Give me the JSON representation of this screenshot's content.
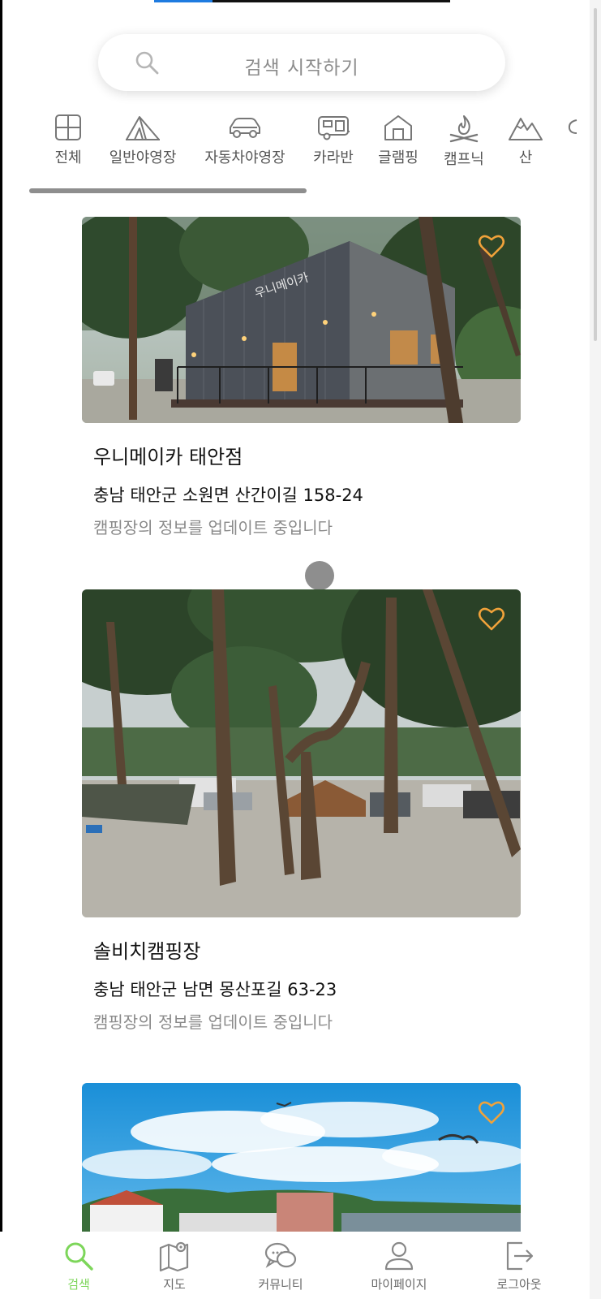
{
  "search": {
    "placeholder": "검색 시작하기"
  },
  "categories": [
    {
      "label": "전체",
      "icon": "grid-icon"
    },
    {
      "label": "일반야영장",
      "icon": "tent-icon"
    },
    {
      "label": "자동차야영장",
      "icon": "car-icon"
    },
    {
      "label": "카라반",
      "icon": "caravan-icon"
    },
    {
      "label": "글램핑",
      "icon": "house-icon"
    },
    {
      "label": "캠프닉",
      "icon": "campfire-icon"
    },
    {
      "label": "산",
      "icon": "mountain-icon"
    }
  ],
  "listings": [
    {
      "name": "우니메이카 태안점",
      "address": "충남 태안군 소원면 산간이길 158-24",
      "status": "캠핑장의 정보를 업데이트 중입니다",
      "sign_text": "우니메이카"
    },
    {
      "name": "솔비치캠핑장",
      "address": "충남 태안군 남면 몽산포길 63-23",
      "status": "캠핑장의 정보를 업데이트 중입니다"
    },
    {
      "name": "",
      "address": "",
      "status": ""
    }
  ],
  "nav": [
    {
      "label": "검색",
      "icon": "search-icon",
      "active": true
    },
    {
      "label": "지도",
      "icon": "map-icon"
    },
    {
      "label": "커뮤니티",
      "icon": "chat-icon"
    },
    {
      "label": "마이페이지",
      "icon": "person-icon"
    },
    {
      "label": "로그아웃",
      "icon": "logout-icon"
    }
  ],
  "colors": {
    "accent_green": "#7dd65a",
    "heart_orange": "#f0a23a",
    "progress_blue": "#1e7be0"
  }
}
